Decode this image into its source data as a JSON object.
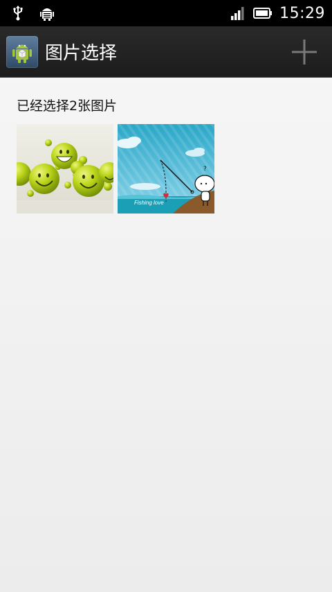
{
  "status_bar": {
    "time": "15:29",
    "icons": [
      "usb-icon",
      "android-debug-icon",
      "signal-icon",
      "battery-icon"
    ]
  },
  "action_bar": {
    "title": "图片选择",
    "app_icon": "android-app-icon",
    "action_icon": "plus-icon"
  },
  "content": {
    "selected_text": "已经选择2张图片",
    "thumbnails": [
      {
        "name": "smiley-balls-image"
      },
      {
        "name": "fishing-love-image",
        "caption": "Fishing love"
      }
    ]
  },
  "colors": {
    "status_bar": "#000000",
    "action_bar": "#1f1f1f",
    "background": "#efefef",
    "smiley_green": "#b5d31a"
  }
}
